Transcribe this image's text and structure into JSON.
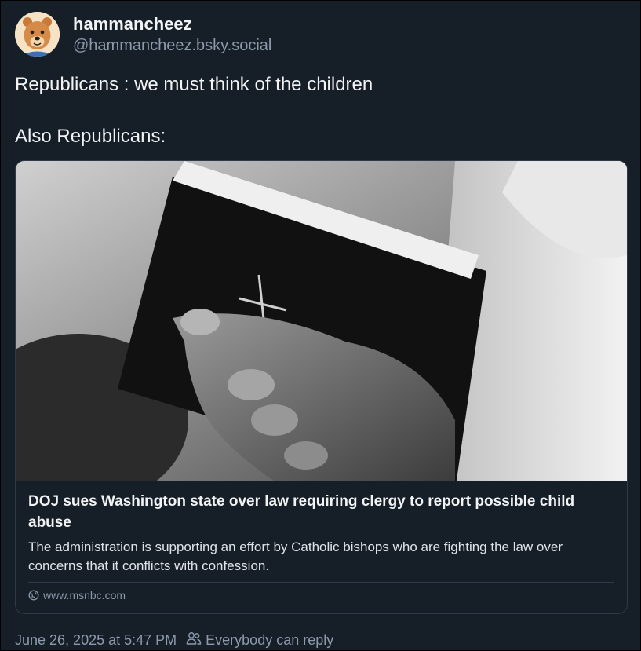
{
  "author": {
    "display_name": "hammancheez",
    "handle": "@hammancheez.bsky.social",
    "avatar_icon": "bear-avatar-icon"
  },
  "post": {
    "lines": [
      "Republicans : we must think of the children",
      "Also Republicans:"
    ]
  },
  "link_card": {
    "image_icon": "hand-holding-bible-photo",
    "title": "DOJ sues Washington state over law requiring clergy to report possible child abuse",
    "description": "The administration is supporting an effort by Catholic bishops who are fighting the law over concerns that it conflicts with confession.",
    "domain": "www.msnbc.com",
    "domain_icon": "globe-icon"
  },
  "footer": {
    "timestamp": "June 26, 2025 at 5:47 PM",
    "reply_setting": "Everybody can reply",
    "reply_icon": "people-icon"
  },
  "colors": {
    "background": "#161e27",
    "text": "#f1f3f5",
    "muted": "#8c9aab",
    "border": "#2e3a48"
  }
}
